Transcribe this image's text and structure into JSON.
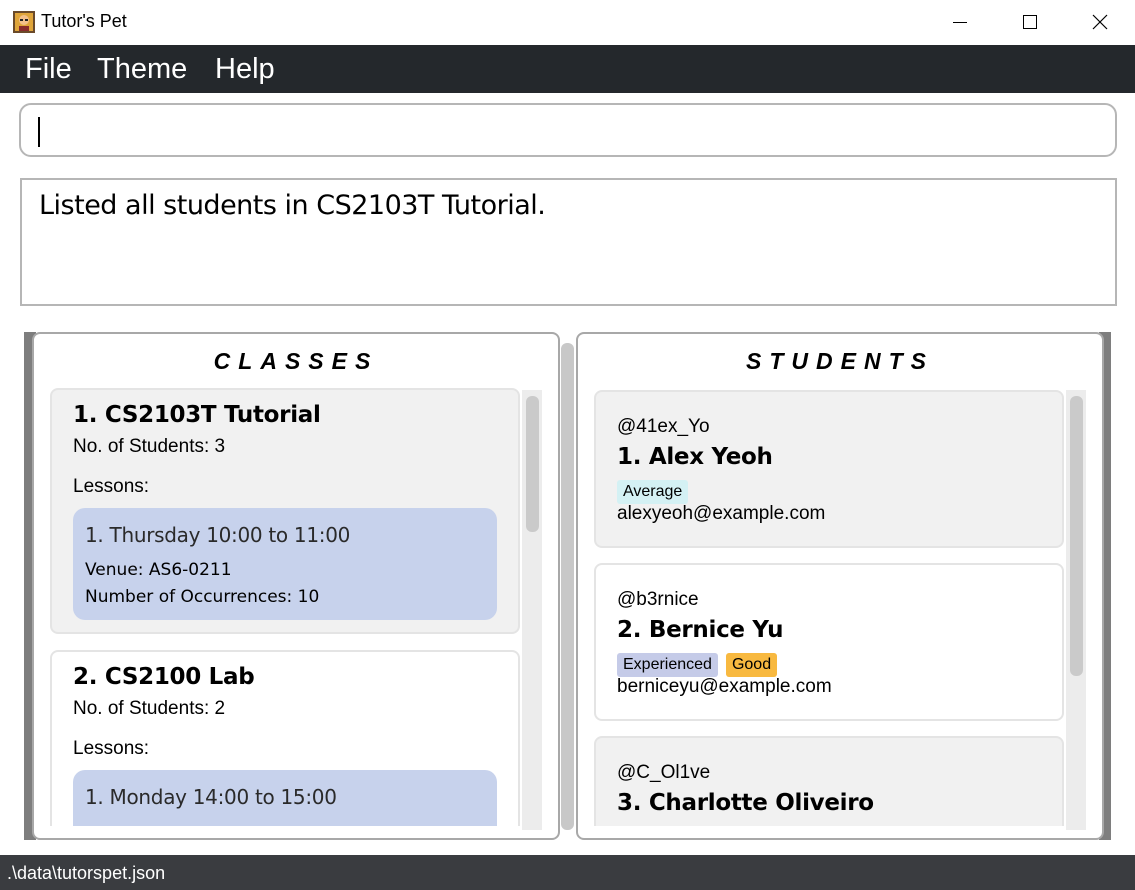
{
  "window": {
    "title": "Tutor's Pet"
  },
  "menu": {
    "items": [
      "File",
      "Theme",
      "Help"
    ]
  },
  "command": {
    "value": ""
  },
  "result": {
    "text": "Listed all students in CS2103T Tutorial."
  },
  "classes_panel": {
    "title": "CLASSES",
    "classes": [
      {
        "title": "1.  CS2103T Tutorial",
        "count_text": "No. of Students:  3",
        "lessons_label": "Lessons:",
        "lesson": {
          "title": "1. Thursday 10:00 to 11:00",
          "venue": "Venue: AS6-0211",
          "occurrences": "Number of Occurrences: 10"
        }
      },
      {
        "title": "2.  CS2100 Lab",
        "count_text": "No. of Students:  2",
        "lessons_label": "Lessons:",
        "lesson": {
          "title": "1. Monday 14:00 to 15:00",
          "venue": "",
          "occurrences": ""
        }
      }
    ]
  },
  "students_panel": {
    "title": "STUDENTS",
    "students": [
      {
        "handle": "@41ex_Yo",
        "name": "1.  Alex Yeoh",
        "tags": [
          {
            "label": "Average",
            "color": "#d4f1f4"
          }
        ],
        "email": "alexyeoh@example.com"
      },
      {
        "handle": "@b3rnice",
        "name": "2.  Bernice Yu",
        "tags": [
          {
            "label": "Experienced",
            "color": "#c5cbe8"
          },
          {
            "label": "Good",
            "color": "#f8b940"
          }
        ],
        "email": "berniceyu@example.com"
      },
      {
        "handle": "@C_Ol1ve",
        "name": "3.  Charlotte Oliveiro",
        "tags": [],
        "email": ""
      }
    ]
  },
  "status": {
    "path": ".\\data\\tutorspet.json"
  },
  "colors": {
    "menu_bg": "#24282c",
    "status_bg": "#3a3c40",
    "lesson_bg": "#c7d2ec",
    "panel_border": "#7e7e7e"
  },
  "icons": [
    "app-icon",
    "minimize-icon",
    "maximize-icon",
    "close-icon"
  ]
}
